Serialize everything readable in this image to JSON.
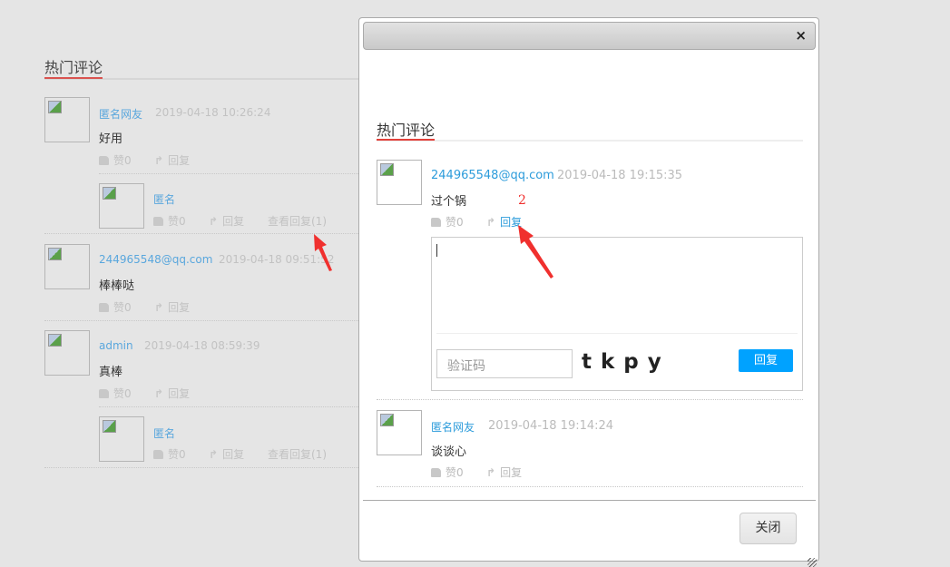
{
  "background": {
    "section_title": "热门评论",
    "comments": [
      {
        "name": "匿名网友",
        "date": "2019-04-18 10:26:24",
        "content": "好用",
        "likes": "赞0",
        "reply": "回复",
        "child": {
          "name": "匿名",
          "likes": "赞0",
          "reply": "回复",
          "view_replies": "查看回复(1)"
        }
      },
      {
        "name": "244965548@qq.com",
        "date": "2019-04-18 09:51:52",
        "content": "棒棒哒",
        "likes": "赞0",
        "reply": "回复"
      },
      {
        "name": "admin",
        "date": "2019-04-18 08:59:39",
        "content": "真棒",
        "likes": "赞0",
        "reply": "回复",
        "child": {
          "name": "匿名",
          "likes": "赞0",
          "reply": "回复",
          "view_replies": "查看回复(1)"
        }
      }
    ]
  },
  "modal": {
    "close_icon": "×",
    "section_title": "热门评论",
    "comments": [
      {
        "name": "244965548@qq.com",
        "date": "2019-04-18 19:15:35",
        "content": "过个锅",
        "likes": "赞0",
        "reply": "回复"
      },
      {
        "name": "匿名网友",
        "date": "2019-04-18 19:14:24",
        "content": "谈谈心",
        "likes": "赞0",
        "reply": "回复"
      }
    ],
    "reply_box": {
      "textarea_value": "",
      "captcha_placeholder": "验证码",
      "captcha_text": "t k p y",
      "submit_label": "回复"
    },
    "annotation": "2",
    "close_button": "关闭"
  },
  "colors": {
    "accent": "#00a2ff",
    "link": "#2d9cdb",
    "underline": "#e2403a",
    "arrow": "#f0302e"
  }
}
